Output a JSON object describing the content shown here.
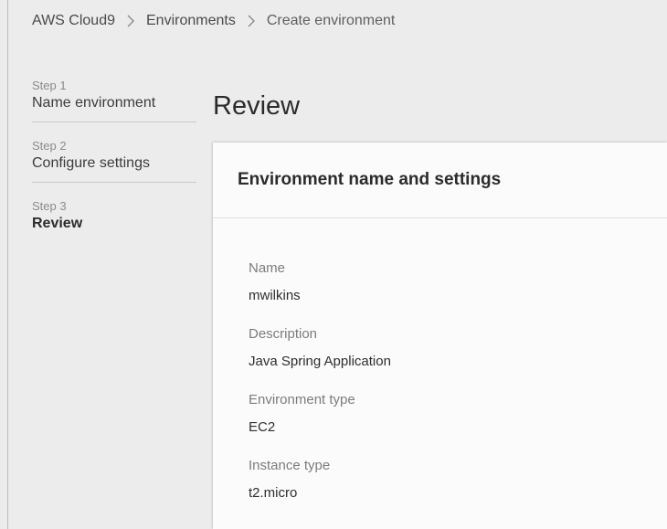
{
  "breadcrumb": {
    "items": [
      "AWS Cloud9",
      "Environments",
      "Create environment"
    ]
  },
  "steps": [
    {
      "number": "Step 1",
      "name": "Name environment"
    },
    {
      "number": "Step 2",
      "name": "Configure settings"
    },
    {
      "number": "Step 3",
      "name": "Review"
    }
  ],
  "active_step": 3,
  "main": {
    "title": "Review",
    "section_title": "Environment name and settings",
    "fields": [
      {
        "label": "Name",
        "value": "mwilkins"
      },
      {
        "label": "Description",
        "value": "Java Spring Application"
      },
      {
        "label": "Environment type",
        "value": "EC2"
      },
      {
        "label": "Instance type",
        "value": "t2.micro"
      }
    ]
  },
  "icons": {
    "breadcrumb_separator": "chevron-right-icon"
  }
}
